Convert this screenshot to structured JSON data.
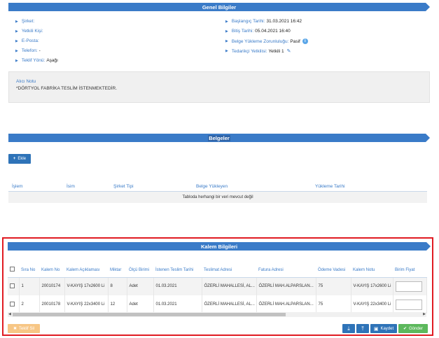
{
  "general": {
    "title": "Genel Bilgiler",
    "left": [
      {
        "label": "Şirket:",
        "value": ""
      },
      {
        "label": "Yetkili Kişi:",
        "value": ""
      },
      {
        "label": "E-Posta:",
        "value": ""
      },
      {
        "label": "Telefon:",
        "value": "-"
      },
      {
        "label": "Teklif Yönü:",
        "value": "Aşağı"
      }
    ],
    "right": [
      {
        "label": "Başlangıç Tarihi:",
        "value": "31.03.2021 16:42"
      },
      {
        "label": "Bitiş Tarihi:",
        "value": "05.04.2021 16:40"
      },
      {
        "label": "Belge Yükleme Zorunluluğu:",
        "value": "Pasif"
      },
      {
        "label": "Tedarikçi Yetkilisi:",
        "value": "Yetkili 1"
      }
    ],
    "note_title": "Alıcı Notu",
    "note_text": "*DÖRTYOL FABRİKA TESLİM İSTENMEKTEDİR."
  },
  "documents": {
    "title": "Belgeler",
    "add_label": "Ekle",
    "columns": [
      "İşlem",
      "İsim",
      "Şirket Tipi",
      "Belge Yükleyen",
      "Yükleme Tarihi"
    ],
    "empty_text": "Tabloda herhangi bir veri mevcut değil"
  },
  "items": {
    "title": "Kalem Bilgileri",
    "columns": [
      "Sıra No",
      "Kalem No",
      "Kalem Açıklaması",
      "Miktar",
      "Ölçü Birimi",
      "İstenen Teslim Tarihi",
      "Teslimat Adresi",
      "Fatura Adresi",
      "Ödeme Vadesi",
      "Kalem Notu",
      "Birim Fiyat"
    ],
    "rows": [
      {
        "sira": "1",
        "kalem_no": "20010174",
        "aciklama": "V-KAYIŞ 17x2600 Li",
        "miktar": "8",
        "birim": "Adet",
        "tarih": "01.03.2021",
        "teslimat": "ÖZERLİ MAHALLESİ, AL...",
        "fatura": "ÖZERLİ MAH.ALPARSLAN...",
        "vade": "75",
        "not": "V-KAYIŞ 17x2600 Li"
      },
      {
        "sira": "2",
        "kalem_no": "20010178",
        "aciklama": "V-KAYIŞ 22x3400 Li",
        "miktar": "12",
        "birim": "Adet",
        "tarih": "01.03.2021",
        "teslimat": "ÖZERLİ MAHALLESİ, AL...",
        "fatura": "ÖZERLİ MAH.ALPARSLAN...",
        "vade": "75",
        "not": "V-KAYIŞ 22x3400 Li"
      }
    ],
    "cancel_label": "Teklif Sil",
    "save_label": "Kaydet",
    "send_label": "Gönder"
  },
  "colors": {
    "accent": "#3a7bc8",
    "highlight_border": "#e01b22",
    "send": "#5cb85c",
    "cancel": "#f7c685"
  }
}
